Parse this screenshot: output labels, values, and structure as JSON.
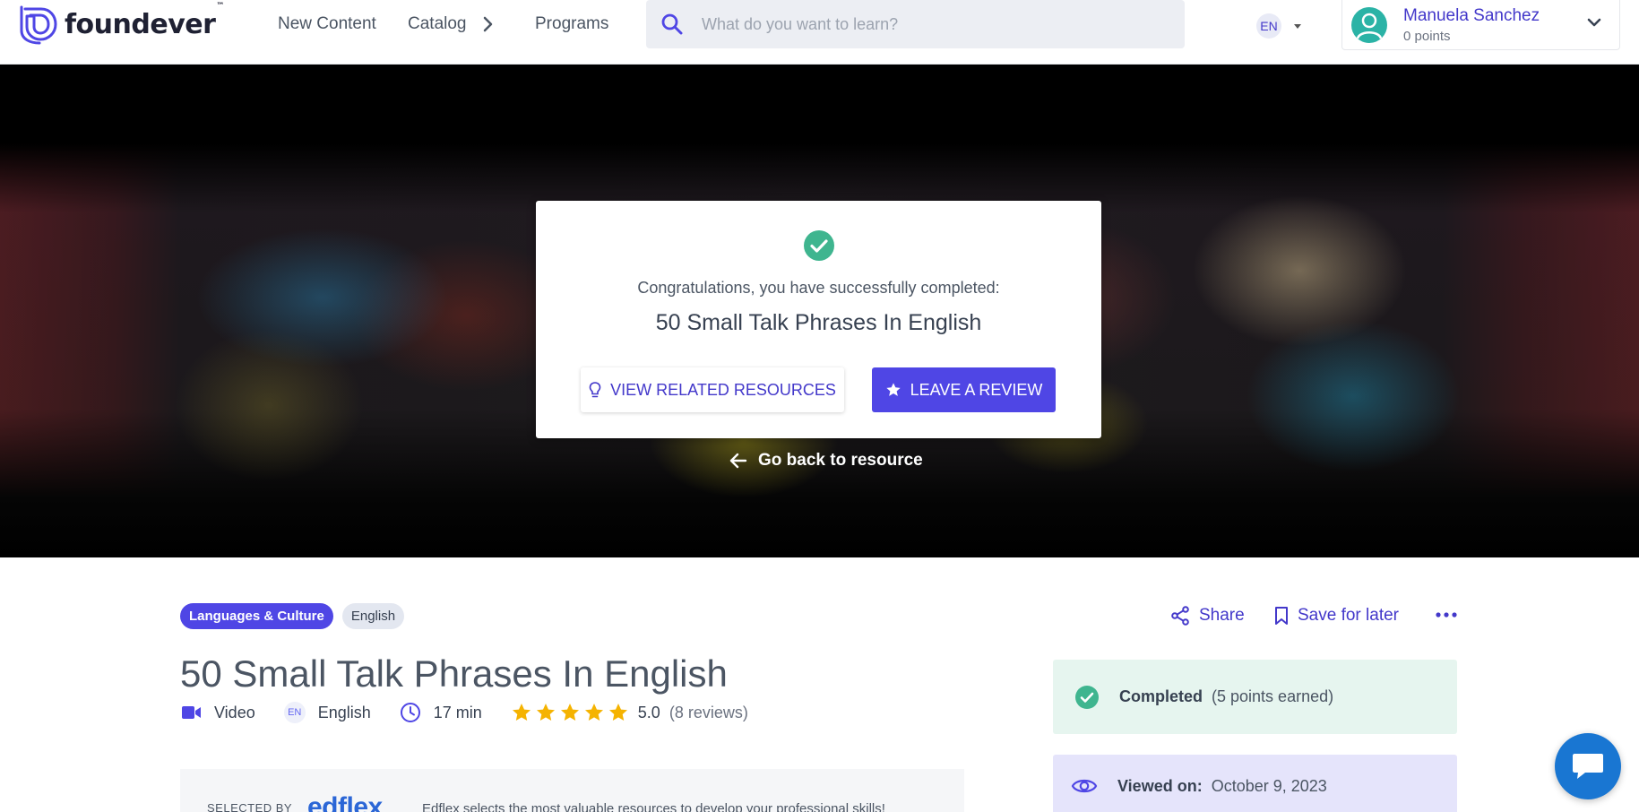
{
  "brand": {
    "name": "foundever",
    "tm": "™",
    "accent": "#4f46e5"
  },
  "nav": {
    "new_content": "New Content",
    "catalog": "Catalog",
    "programs": "Programs"
  },
  "search": {
    "placeholder": "What do you want to learn?",
    "value": ""
  },
  "language": {
    "code": "EN"
  },
  "user": {
    "name": "Manuela Sanchez",
    "points": "0 points"
  },
  "completion_card": {
    "message": "Congratulations, you have successfully completed:",
    "title": "50 Small Talk Phrases In English",
    "related_button": "VIEW RELATED RESOURCES",
    "review_button": "LEAVE A REVIEW"
  },
  "hero": {
    "back_link": "Go back to resource"
  },
  "resource": {
    "tags": [
      "Languages & Culture",
      "English"
    ],
    "title": "50 Small Talk Phrases In English",
    "type": "Video",
    "language_badge": "EN",
    "language": "English",
    "duration": "17 min",
    "rating": "5.0",
    "rating_stars": 5,
    "reviews": "(8 reviews)"
  },
  "actions": {
    "share": "Share",
    "save": "Save for later"
  },
  "selected": {
    "label": "SELECTED BY",
    "provider": "edflex",
    "description": "Edflex selects the most valuable resources to develop your professional skills!"
  },
  "status": {
    "completed_label": "Completed",
    "completed_points": "(5 points earned)",
    "viewed_label": "Viewed on:",
    "viewed_date": "October 9, 2023"
  },
  "colors": {
    "primary": "#4f46e5",
    "success": "#3fb58f",
    "completed_bg": "#e6f5ef",
    "viewed_bg": "#e5e4fb",
    "star": "#f5b301",
    "chat": "#1976d2"
  },
  "icons": [
    "logo-icon",
    "chevron-right-icon",
    "search-icon",
    "caret-down-icon",
    "avatar-icon",
    "chevron-down-icon",
    "check-circle-icon",
    "lightbulb-icon",
    "star-icon",
    "arrow-left-icon",
    "share-icon",
    "bookmark-icon",
    "more-icon",
    "video-icon",
    "clock-icon",
    "eye-icon",
    "chat-icon"
  ]
}
